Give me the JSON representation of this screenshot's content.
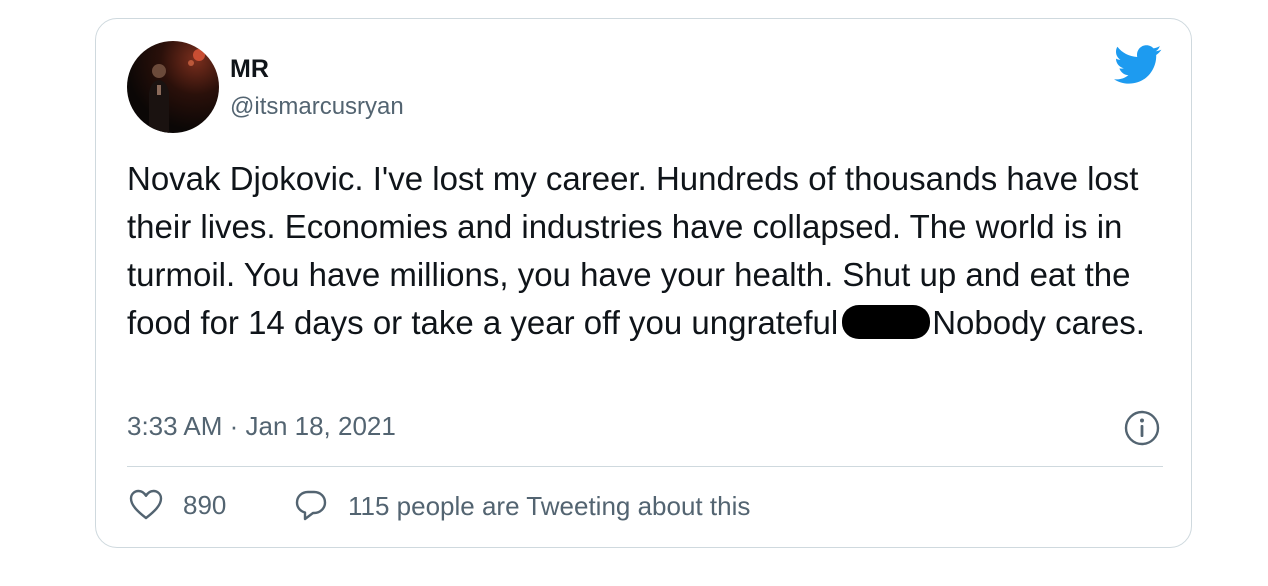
{
  "tweet": {
    "author_name": "MR",
    "author_handle": "@itsmarcusryan",
    "text_before": "Novak Djokovic. I've lost my career. Hundreds of thousands have lost their lives. Economies and industries have collapsed. The world is in turmoil. You have millions, you have your health. Shut up and eat the food for 14 days or take a year off you ungrateful",
    "text_after": "Nobody cares.",
    "timestamp": "3:33 AM · Jan 18, 2021",
    "likes_count": "890",
    "tweeting_text": "115 people are Tweeting about this"
  },
  "icons": {
    "brand": "twitter-bird-icon",
    "info": "info-icon",
    "like": "heart-icon",
    "reply": "reply-bubble-icon"
  },
  "colors": {
    "brand_blue": "#1d9bf0",
    "text_primary": "#0f1419",
    "text_secondary": "#536471",
    "border": "#cfd9de"
  }
}
